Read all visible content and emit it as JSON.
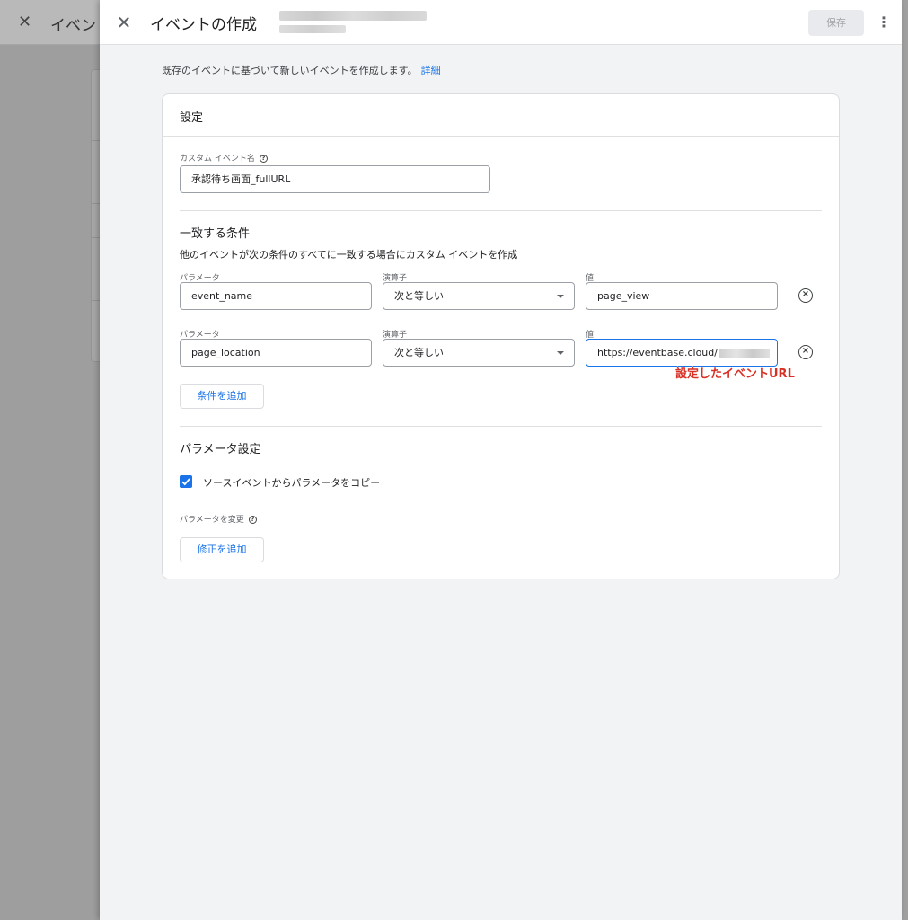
{
  "background": {
    "title": "イベン"
  },
  "header": {
    "title": "イベントの作成",
    "save_label": "保存"
  },
  "intro": {
    "text": "既存のイベントに基づいて新しいイベントを作成します。",
    "link": "詳細"
  },
  "settings": {
    "title": "設定",
    "custom_event_name_label": "カスタム イベント名",
    "custom_event_name_value": "承認待ち画面_fullURL"
  },
  "conditions": {
    "title": "一致する条件",
    "description": "他のイベントが次の条件のすべてに一致する場合にカスタム イベントを作成",
    "param_label": "パラメータ",
    "operator_label": "演算子",
    "value_label": "値",
    "rows": [
      {
        "param": "event_name",
        "operator": "次と等しい",
        "value": "page_view"
      },
      {
        "param": "page_location",
        "operator": "次と等しい",
        "value": "https://eventbase.cloud/"
      }
    ],
    "add_label": "条件を追加"
  },
  "param_settings": {
    "title": "パラメータ設定",
    "copy_label": "ソースイベントからパラメータをコピー",
    "copy_checked": true,
    "modify_label": "パラメータを変更",
    "add_modify_label": "修正を追加"
  },
  "annotation": "設定したイベントURL",
  "colors": {
    "accent": "#1a73e8",
    "annotation": "#d93025"
  }
}
